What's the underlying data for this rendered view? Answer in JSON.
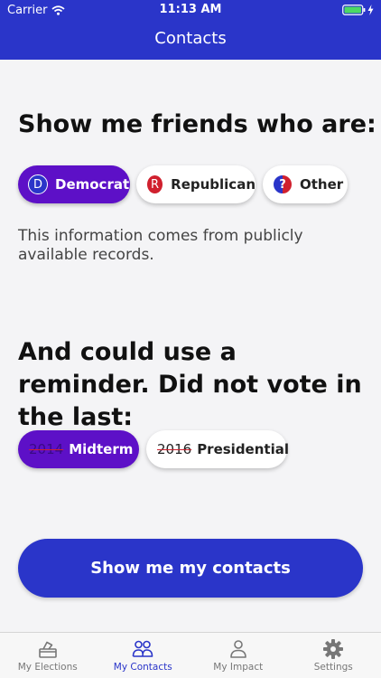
{
  "status_bar": {
    "carrier": "Carrier",
    "time": "11:13 AM"
  },
  "header": {
    "title": "Contacts"
  },
  "filter": {
    "heading": "Show me friends who are:",
    "options": [
      {
        "badge": "D",
        "label": "Democrat",
        "selected": true
      },
      {
        "badge": "R",
        "label": "Republican",
        "selected": false
      },
      {
        "badge": "?",
        "label": "Other",
        "selected": false
      }
    ],
    "info": "This information comes from publicly available records."
  },
  "reminder": {
    "heading": "And could use a reminder. Did not vote in the last:",
    "options": [
      {
        "year": "2014",
        "label": "Midterm",
        "selected": true
      },
      {
        "year": "2016",
        "label": "Presidential",
        "selected": false
      }
    ]
  },
  "cta": {
    "label": "Show me my contacts"
  },
  "tabbar": {
    "items": [
      {
        "label": "My Elections",
        "icon": "ballot-box-icon",
        "active": false
      },
      {
        "label": "My Contacts",
        "icon": "people-icon",
        "active": true
      },
      {
        "label": "My Impact",
        "icon": "person-icon",
        "active": false
      },
      {
        "label": "Settings",
        "icon": "gear-icon",
        "active": false
      }
    ]
  },
  "colors": {
    "primary": "#2a35c9",
    "selected": "#5d10c7",
    "republican": "#d0202e"
  }
}
